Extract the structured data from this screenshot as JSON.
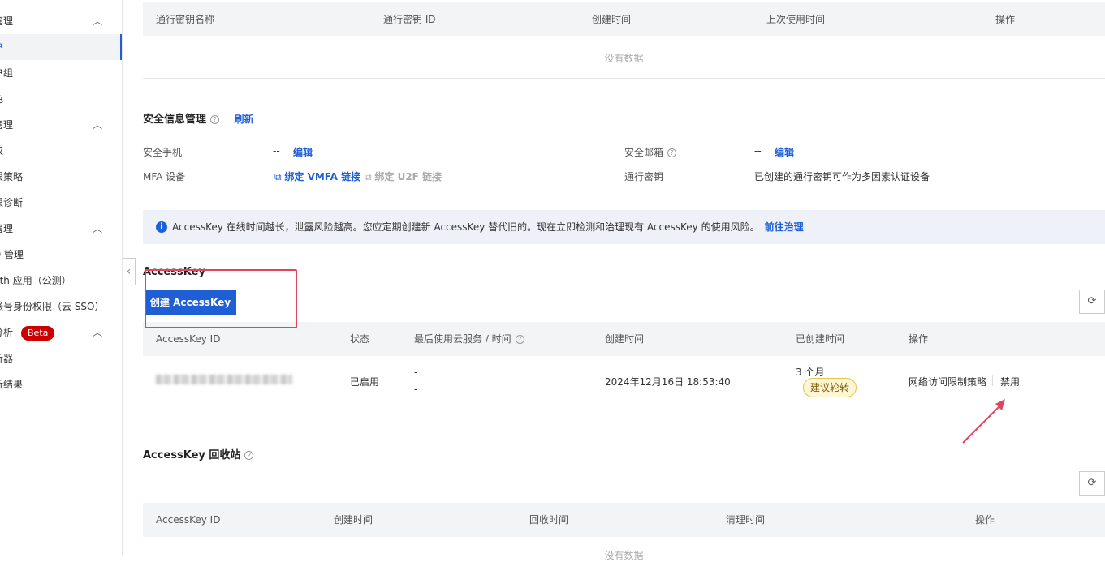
{
  "sidebar": {
    "items": [
      {
        "label": "管理",
        "chevron": "︿"
      },
      {
        "label": "户"
      },
      {
        "label": "户组"
      },
      {
        "label": "色"
      },
      {
        "label": "管理",
        "chevron": "︿"
      },
      {
        "label": "权"
      },
      {
        "label": "限策略"
      },
      {
        "label": "限诊断"
      },
      {
        "label": "管理",
        "chevron": "︿"
      },
      {
        "label": "D 管理"
      },
      {
        "label": "uth 应用（公测）"
      },
      {
        "label": "账号身份权限（云 SSO）"
      },
      {
        "label": "分析",
        "badge": "Beta",
        "chevron": "︿"
      },
      {
        "label": "析器"
      },
      {
        "label": "析结果"
      }
    ],
    "collapse_icon": "‹"
  },
  "passkey_table": {
    "headers": [
      "通行密钥名称",
      "通行密钥 ID",
      "创建时间",
      "上次使用时间",
      "操作"
    ],
    "empty": "没有数据"
  },
  "security": {
    "title": "安全信息管理",
    "refresh": "刷新",
    "phone_label": "安全手机",
    "phone_value": "--",
    "phone_edit": "编辑",
    "email_label": "安全邮箱",
    "email_value": "--",
    "email_edit": "编辑",
    "mfa_label": "MFA 设备",
    "mfa_vmfa": "绑定 VMFA 链接",
    "mfa_u2f": "绑定 U2F 链接",
    "passkey_label": "通行密钥",
    "passkey_value": "已创建的通行密钥可作为多因素认证设备"
  },
  "notice": {
    "text": "AccessKey 在线时间越长，泄露风险越高。您应定期创建新 AccessKey 替代旧的。现在立即检测和治理现有 AccessKey 的使用风险。",
    "link": "前往治理"
  },
  "accesskey": {
    "title": "AccessKey",
    "create_button": "创建 AccessKey",
    "headers": [
      "AccessKey ID",
      "状态",
      "最后使用云服务 / 时间",
      "创建时间",
      "已创建时间",
      "操作"
    ],
    "rows": [
      {
        "status": "已启用",
        "last_service": "-",
        "last_time": "-",
        "created": "2024年12月16日 18:53:40",
        "age": "3 个月",
        "age_tag": "建议轮转",
        "action_policy": "网络访问限制策略",
        "action_disable": "禁用"
      }
    ]
  },
  "recycle": {
    "title": "AccessKey 回收站",
    "headers": [
      "AccessKey ID",
      "创建时间",
      "回收时间",
      "清理时间",
      "操作"
    ],
    "empty": "没有数据"
  },
  "colors": {
    "accent": "#1f5fd6",
    "highlight_box": "#e0455f",
    "beta_badge": "#cc0000"
  }
}
